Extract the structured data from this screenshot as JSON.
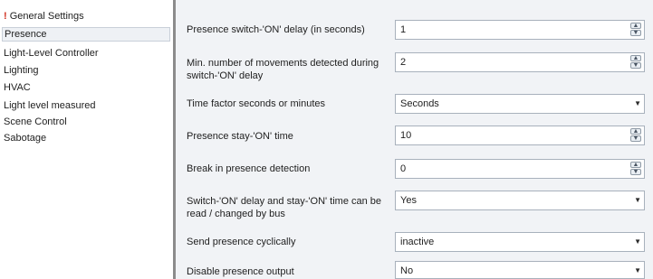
{
  "sidebar": {
    "items": [
      {
        "label": "General Settings",
        "warning": "!"
      },
      {
        "label": "Presence"
      },
      {
        "label": "Light-Level Controller"
      },
      {
        "label": "Lighting"
      },
      {
        "label": "HVAC"
      },
      {
        "label": "Light level measured"
      },
      {
        "label": "Scene Control"
      },
      {
        "label": "Sabotage"
      }
    ]
  },
  "params": [
    {
      "label": "Presence switch-'ON' delay (in seconds)",
      "value": "1",
      "control": "spinner"
    },
    {
      "label": "Min. number of movements detected during switch-'ON' delay",
      "value": "2",
      "control": "spinner"
    },
    {
      "label": "Time factor seconds or minutes",
      "value": "Seconds",
      "control": "dropdown"
    },
    {
      "label": "Presence stay-'ON' time",
      "value": "10",
      "control": "spinner"
    },
    {
      "label": "Break in presence detection",
      "value": "0",
      "control": "spinner"
    },
    {
      "label": "Switch-'ON' delay and stay-'ON' time can be read / changed by bus",
      "value": "Yes",
      "control": "dropdown"
    },
    {
      "label": "Send presence cyclically",
      "value": "inactive",
      "control": "dropdown"
    },
    {
      "label": "Disable presence output",
      "value": "No",
      "control": "dropdown"
    }
  ],
  "icons": {
    "spin_up": "▲",
    "spin_down": "▼",
    "dropdown_arrow": "▼"
  }
}
